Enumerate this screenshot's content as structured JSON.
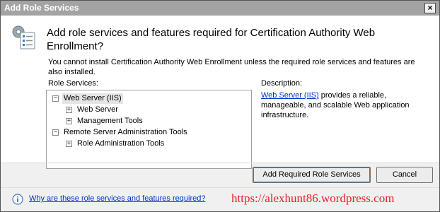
{
  "window": {
    "title": "Add Role Services",
    "close_glyph": "×"
  },
  "header": {
    "icon": "role-services-icon",
    "heading": "Add role services and features required for Certification Authority Web Enrollment?",
    "info": "You cannot install Certification Authority Web Enrollment unless the required role services and features are also installed."
  },
  "role_services": {
    "label": "Role Services:",
    "tree": [
      {
        "label": "Web Server (IIS)",
        "expander": "−",
        "selected": true
      },
      {
        "label": "Web Server",
        "expander": "+"
      },
      {
        "label": "Management Tools",
        "expander": "+"
      },
      {
        "label": "Remote Server Administration Tools",
        "expander": "−"
      },
      {
        "label": "Role Administration Tools",
        "expander": "+"
      }
    ]
  },
  "description": {
    "label": "Description:",
    "link_text": "Web Server (IIS)",
    "body": " provides a reliable, manageable, and scalable Web application infrastructure."
  },
  "buttons": {
    "add": "Add Required Role Services",
    "cancel": "Cancel"
  },
  "footer": {
    "link": "Why are these role services and features required?",
    "watermark": "https://alexhunt86.wordpress.com"
  },
  "colors": {
    "link": "#0033cc",
    "watermark": "#e8212b",
    "titlebar": "#a3a3a3"
  }
}
